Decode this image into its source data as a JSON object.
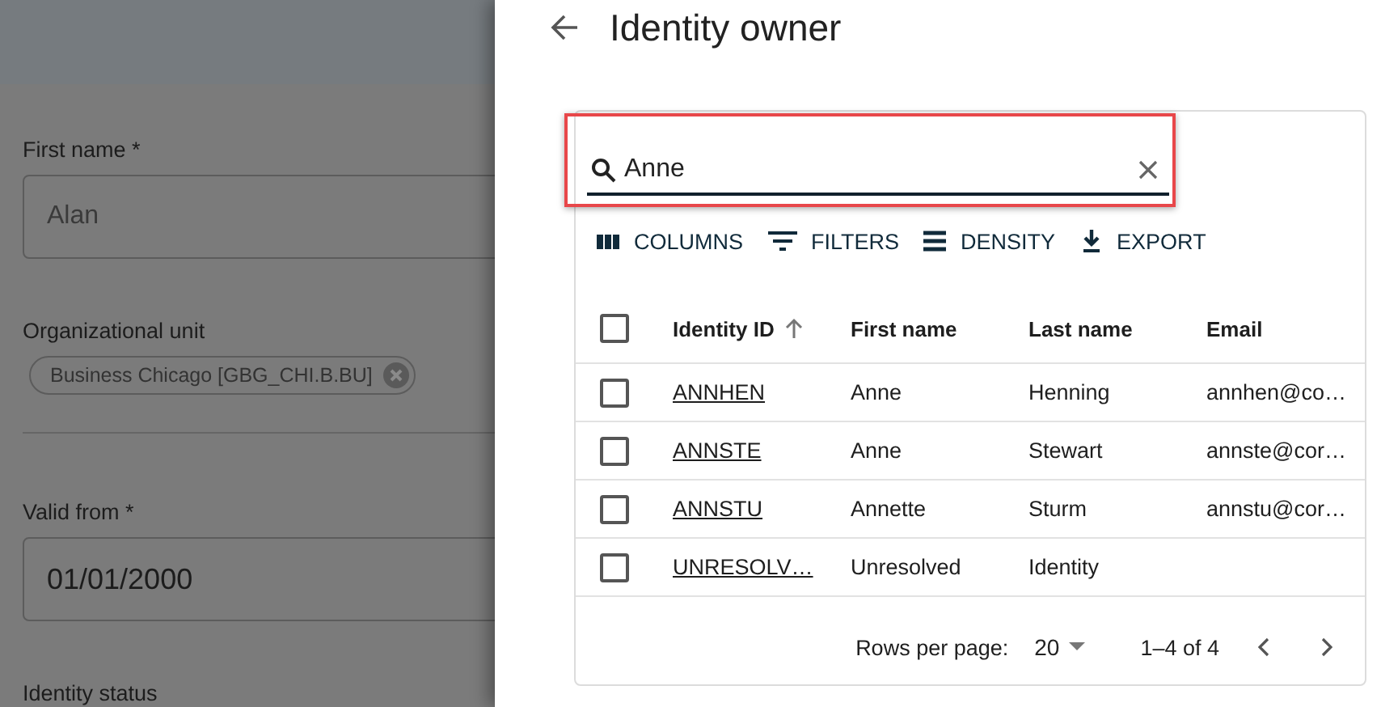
{
  "background_form": {
    "fields": [
      {
        "kind": "input",
        "label": "First name *",
        "value": "Alan"
      },
      {
        "kind": "chip",
        "label": "Organizational unit",
        "value": "Business Chicago [GBG_CHI.B.BU]"
      },
      {
        "kind": "divider"
      },
      {
        "kind": "input",
        "label": "Valid from *",
        "value": "01/01/2000"
      },
      {
        "kind": "label",
        "label": "Identity status"
      }
    ]
  },
  "drawer": {
    "title": "Identity owner",
    "search": {
      "value": "Anne",
      "highlighted": true
    },
    "toolbar": [
      {
        "kind": "columns",
        "label": "COLUMNS"
      },
      {
        "kind": "filters",
        "label": "FILTERS"
      },
      {
        "kind": "density",
        "label": "DENSITY"
      },
      {
        "kind": "export",
        "label": "EXPORT"
      }
    ],
    "table": {
      "select_all": {
        "checked": false
      },
      "columns": [
        {
          "label": "Identity ID",
          "sorted": true
        },
        {
          "label": "First name",
          "sorted": false
        },
        {
          "label": "Last name",
          "sorted": false
        },
        {
          "label": "Email",
          "sorted": false
        }
      ],
      "rows": [
        {
          "checked": false,
          "cells": [
            "ANNHEN",
            "Anne",
            "Henning",
            "annhen@co…"
          ]
        },
        {
          "checked": false,
          "cells": [
            "ANNSTE",
            "Anne",
            "Stewart",
            "annste@cor…"
          ]
        },
        {
          "checked": false,
          "cells": [
            "ANNSTU",
            "Annette",
            "Sturm",
            "annstu@cor…"
          ]
        },
        {
          "checked": false,
          "cells": [
            "UNRESOLV…",
            "Unresolved",
            "Identity",
            ""
          ]
        }
      ]
    },
    "pagination": {
      "rows_per_page_label": "Rows per page:",
      "rows_per_page": "20",
      "range": "1–4 of 4"
    }
  }
}
